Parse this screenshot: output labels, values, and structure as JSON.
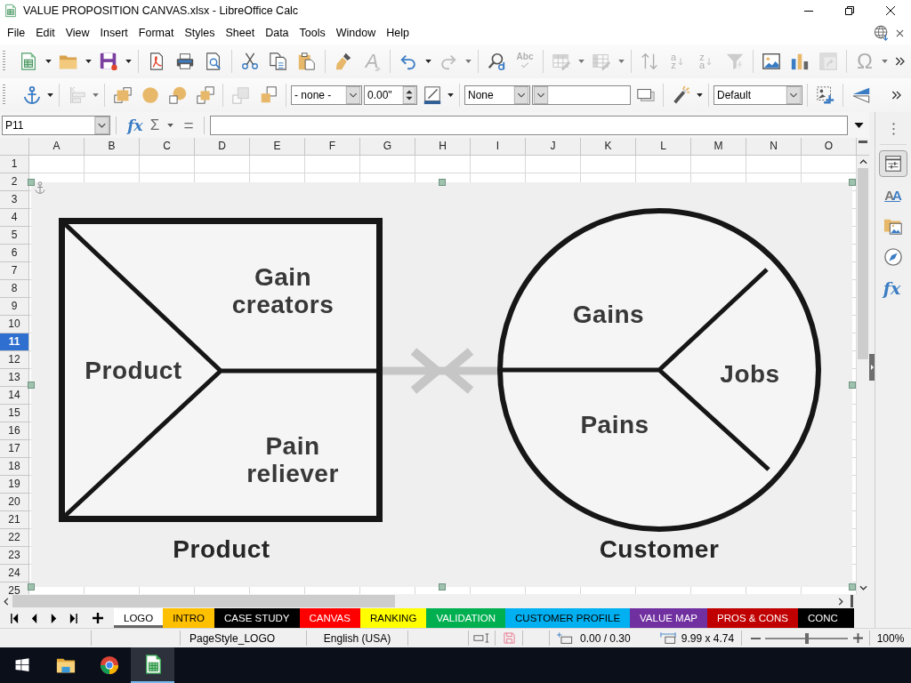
{
  "window": {
    "title": "VALUE PROPOSITION CANVAS.xlsx - LibreOffice Calc"
  },
  "menu_bar": [
    "File",
    "Edit",
    "View",
    "Insert",
    "Format",
    "Styles",
    "Sheet",
    "Data",
    "Tools",
    "Window",
    "Help"
  ],
  "standard_toolbar": [
    {
      "kind": "new",
      "disabled": false,
      "dropdown": true
    },
    {
      "kind": "open",
      "disabled": false,
      "dropdown": true
    },
    {
      "kind": "save",
      "disabled": false,
      "dropdown": true
    },
    {
      "kind": "separator"
    },
    {
      "kind": "export-pdf",
      "disabled": false,
      "dropdown": false
    },
    {
      "kind": "print",
      "disabled": false,
      "dropdown": false
    },
    {
      "kind": "print-preview",
      "disabled": false,
      "dropdown": false
    },
    {
      "kind": "separator"
    },
    {
      "kind": "cut",
      "disabled": false,
      "dropdown": false
    },
    {
      "kind": "copy",
      "disabled": false,
      "dropdown": false
    },
    {
      "kind": "paste",
      "disabled": false,
      "dropdown": false
    },
    {
      "kind": "separator"
    },
    {
      "kind": "clone-formatting",
      "disabled": false,
      "dropdown": false
    },
    {
      "kind": "clear-formatting",
      "disabled": true,
      "dropdown": false,
      "glyph": "A"
    },
    {
      "kind": "separator"
    },
    {
      "kind": "undo",
      "disabled": false,
      "dropdown": true
    },
    {
      "kind": "redo",
      "disabled": true,
      "dropdown": true
    },
    {
      "kind": "separator"
    },
    {
      "kind": "find-replace",
      "disabled": false,
      "dropdown": false
    },
    {
      "kind": "spelling",
      "disabled": true,
      "dropdown": false,
      "glyph": "Abc"
    },
    {
      "kind": "separator"
    },
    {
      "kind": "row",
      "disabled": true,
      "dropdown": true
    },
    {
      "kind": "column",
      "disabled": true,
      "dropdown": true
    },
    {
      "kind": "separator"
    },
    {
      "kind": "sort",
      "disabled": true,
      "dropdown": false
    },
    {
      "kind": "sort-ascending",
      "disabled": true,
      "dropdown": false,
      "glyph": "az"
    },
    {
      "kind": "sort-descending",
      "disabled": true,
      "dropdown": false,
      "glyph": "za"
    },
    {
      "kind": "autofilter",
      "disabled": true,
      "dropdown": false
    },
    {
      "kind": "separator"
    },
    {
      "kind": "insert-image",
      "disabled": false,
      "dropdown": false
    },
    {
      "kind": "insert-chart",
      "disabled": false,
      "dropdown": false
    },
    {
      "kind": "pivot-table",
      "disabled": true,
      "dropdown": false
    },
    {
      "kind": "separator"
    },
    {
      "kind": "special-character",
      "disabled": true,
      "dropdown": true,
      "glyph": "Ω"
    },
    {
      "kind": "overflow",
      "disabled": false,
      "dropdown": false
    }
  ],
  "drawing_toolbar": [
    {
      "kind": "anchor",
      "disabled": false,
      "dropdown": true
    },
    {
      "kind": "separator"
    },
    {
      "kind": "align-objects",
      "disabled": true,
      "dropdown": true
    },
    {
      "kind": "separator"
    },
    {
      "kind": "bring-to-front",
      "disabled": false,
      "dropdown": false
    },
    {
      "kind": "bring-forward",
      "disabled": false,
      "dropdown": false
    },
    {
      "kind": "send-backward",
      "disabled": false,
      "dropdown": false
    },
    {
      "kind": "send-to-back",
      "disabled": false,
      "dropdown": false
    },
    {
      "kind": "separator"
    },
    {
      "kind": "to-foreground",
      "disabled": true,
      "dropdown": false
    },
    {
      "kind": "to-background",
      "disabled": false,
      "dropdown": false
    },
    {
      "kind": "separator"
    },
    {
      "kind": "combo",
      "value": "- none -"
    },
    {
      "kind": "spin",
      "value": "0.00\""
    },
    {
      "kind": "line-color",
      "disabled": false,
      "dropdown": true
    },
    {
      "kind": "separator"
    },
    {
      "kind": "combo",
      "value": "None"
    },
    {
      "kind": "combo"
    },
    {
      "kind": "shadow",
      "disabled": false,
      "dropdown": false
    },
    {
      "kind": "separator"
    },
    {
      "kind": "transformations",
      "disabled": false,
      "dropdown": true
    },
    {
      "kind": "separator"
    },
    {
      "kind": "combo",
      "value": "Default"
    },
    {
      "kind": "separator"
    },
    {
      "kind": "crop",
      "disabled": false,
      "dropdown": false
    },
    {
      "kind": "separator"
    },
    {
      "kind": "flip",
      "disabled": false,
      "dropdown": false
    },
    {
      "kind": "overflow",
      "disabled": false,
      "dropdown": false
    }
  ],
  "formula_bar": {
    "name_box": "P11",
    "buttons": [
      {
        "kind": "function-wizard",
        "glyph": "fx",
        "dropdown": false
      },
      {
        "kind": "sum",
        "glyph": "Σ",
        "dropdown": true
      },
      {
        "kind": "formula",
        "glyph": "=",
        "dropdown": false
      }
    ]
  },
  "sheet": {
    "columns": [
      "A",
      "B",
      "C",
      "D",
      "E",
      "F",
      "G",
      "H",
      "I",
      "J",
      "K",
      "L",
      "M",
      "N",
      "O"
    ],
    "rows": [
      {
        "label": "1",
        "selected": false
      },
      {
        "label": "2",
        "selected": false
      },
      {
        "label": "3",
        "selected": false
      },
      {
        "label": "4",
        "selected": false
      },
      {
        "label": "5",
        "selected": false
      },
      {
        "label": "6",
        "selected": false
      },
      {
        "label": "7",
        "selected": false
      },
      {
        "label": "8",
        "selected": false
      },
      {
        "label": "9",
        "selected": false
      },
      {
        "label": "10",
        "selected": false
      },
      {
        "label": "11",
        "selected": true
      },
      {
        "label": "12",
        "selected": false
      },
      {
        "label": "13",
        "selected": false
      },
      {
        "label": "14",
        "selected": false
      },
      {
        "label": "15",
        "selected": false
      },
      {
        "label": "16",
        "selected": false
      },
      {
        "label": "17",
        "selected": false
      },
      {
        "label": "18",
        "selected": false
      },
      {
        "label": "19",
        "selected": false
      },
      {
        "label": "20",
        "selected": false
      },
      {
        "label": "21",
        "selected": false
      },
      {
        "label": "22",
        "selected": false
      },
      {
        "label": "23",
        "selected": false
      },
      {
        "label": "24",
        "selected": false
      },
      {
        "label": "25",
        "selected": false
      }
    ],
    "image": {
      "selected": true,
      "product_sections": [
        "Gain creators",
        "Product",
        "Pain reliever"
      ],
      "product_caption": "Product",
      "customer_sections": [
        "Gains",
        "Jobs",
        "Pains"
      ],
      "customer_caption": "Customer"
    }
  },
  "sheet_tabs": [
    {
      "label": "LOGO",
      "selected": true
    },
    {
      "label": "INTRO",
      "selected": false,
      "color": "#ffc000"
    },
    {
      "label": "CASE STUDY",
      "selected": false,
      "color": "#000000"
    },
    {
      "label": "CANVAS",
      "selected": false,
      "color": "#ff0000"
    },
    {
      "label": "RANKING",
      "selected": false,
      "color": "#ffff00"
    },
    {
      "label": "VALIDATION",
      "selected": false,
      "color": "#00b050"
    },
    {
      "label": "CUSTOMER PROFILE",
      "selected": false,
      "color": "#00b0f0"
    },
    {
      "label": "VALUE MAP",
      "selected": false,
      "color": "#7030a0"
    },
    {
      "label": "PROS & CONS",
      "selected": false,
      "color": "#c00000"
    },
    {
      "label": "CONC",
      "selected": false,
      "color": "#000000"
    }
  ],
  "sidebar": [
    {
      "kind": "properties",
      "selected": true
    },
    {
      "kind": "styles",
      "selected": false,
      "glyph": "AA"
    },
    {
      "kind": "gallery",
      "selected": false
    },
    {
      "kind": "navigator",
      "selected": false
    },
    {
      "kind": "functions",
      "selected": false,
      "glyph": "fx"
    }
  ],
  "status_bar": {
    "page_style": "PageStyle_LOGO",
    "language": "English (USA)",
    "document_modified": true,
    "position": "0.00 / 0.30",
    "size": "9.99 x 4.74",
    "zoom": {
      "level": 0.5,
      "reading": "100%"
    }
  },
  "taskbar": [
    {
      "kind": "start",
      "active": false
    },
    {
      "kind": "file-explorer",
      "active": false
    },
    {
      "kind": "browser",
      "active": false
    },
    {
      "kind": "spreadsheet",
      "active": true
    }
  ]
}
